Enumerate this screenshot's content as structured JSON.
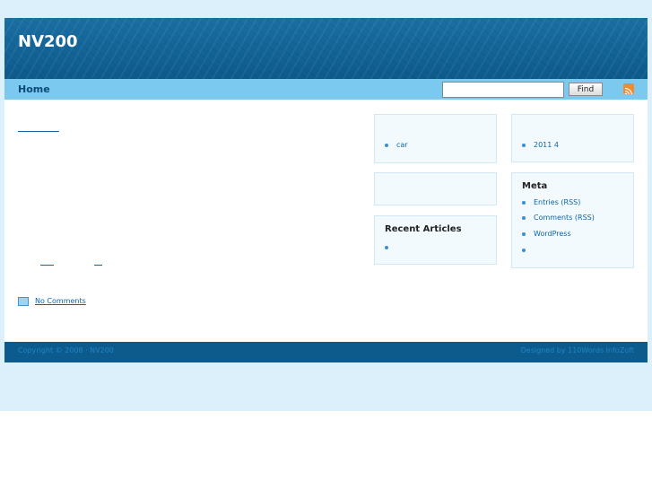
{
  "site": {
    "title": "NV200"
  },
  "nav": {
    "home_label": "Home"
  },
  "search": {
    "value": "",
    "placeholder": "",
    "button_label": "Find"
  },
  "icons": {
    "rss": "rss-feed-icon",
    "comments": "comment-icon",
    "bullet": "bullet-icon"
  },
  "post": {
    "comments_label": "No Comments"
  },
  "sidebar": {
    "categories": {
      "items": [
        "car"
      ]
    },
    "archives": {
      "items": [
        "2011 4"
      ]
    },
    "recent": {
      "title": "Recent Articles",
      "items": [
        ""
      ]
    },
    "meta": {
      "title": "Meta",
      "items": [
        "Entries (RSS)",
        "Comments (RSS)",
        "WordPress",
        ""
      ]
    }
  },
  "footer": {
    "copyright": "Copyright © 2008 · NV200",
    "credit": "Designed by 110Words InfoZoft"
  },
  "colors": {
    "header": "#0d5a8c",
    "navbar": "#7cc9ef",
    "page_bg": "#dcf0fb",
    "link": "#0b64a8",
    "box_bg": "#f3fafe"
  }
}
